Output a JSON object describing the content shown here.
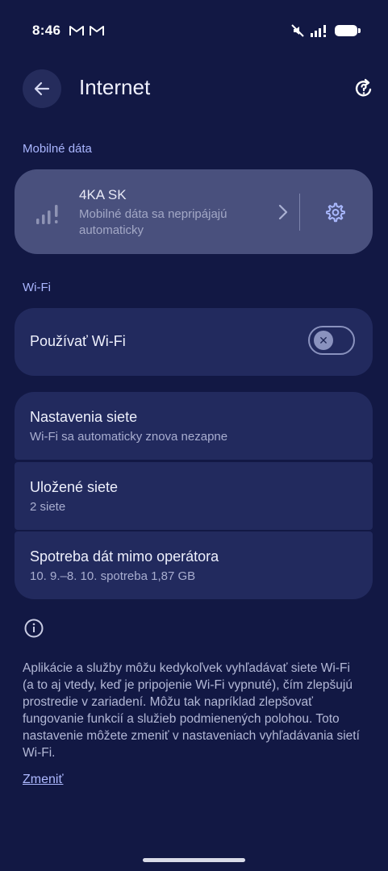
{
  "status_bar": {
    "time": "8:46",
    "left_icons": [
      "gmail-icon",
      "gmail-icon"
    ],
    "right_icons": [
      "mute-icon",
      "signal-icon",
      "battery-icon"
    ]
  },
  "header": {
    "title": "Internet",
    "back_icon": "arrow-left-icon",
    "help_icon": "help-refresh-icon"
  },
  "mobile_data": {
    "section_label": "Mobilné dáta",
    "carrier": "4KA SK",
    "status": "Mobilné dáta sa nepripájajú automaticky"
  },
  "wifi": {
    "section_label": "Wi-Fi",
    "use_wifi_label": "Používať Wi-Fi",
    "enabled": false
  },
  "items": [
    {
      "title": "Nastavenia siete",
      "subtitle": "Wi-Fi sa automaticky znova nezapne"
    },
    {
      "title": "Uložené siete",
      "subtitle": "2 siete"
    },
    {
      "title": "Spotreba dát mimo operátora",
      "subtitle": "10. 9.–8. 10. spotreba 1,87 GB"
    }
  ],
  "info": {
    "text": "Aplikácie a služby môžu kedykoľvek vyhľadávať siete Wi-Fi (a to aj vtedy, keď je pripojenie Wi-Fi vypnuté), čím zlepšujú prostredie v zariadení. Môžu tak napríklad zlepšovať fungovanie funkcií a služieb podmienených polohou. Toto nastavenie môžete zmeniť v nastaveniach vyhľadávania sietí Wi-Fi.",
    "link": "Zmeniť"
  },
  "colors": {
    "background": "#121844",
    "card": "#222a5e",
    "mobile_card": "#49507d",
    "accent": "#aab6ff"
  }
}
